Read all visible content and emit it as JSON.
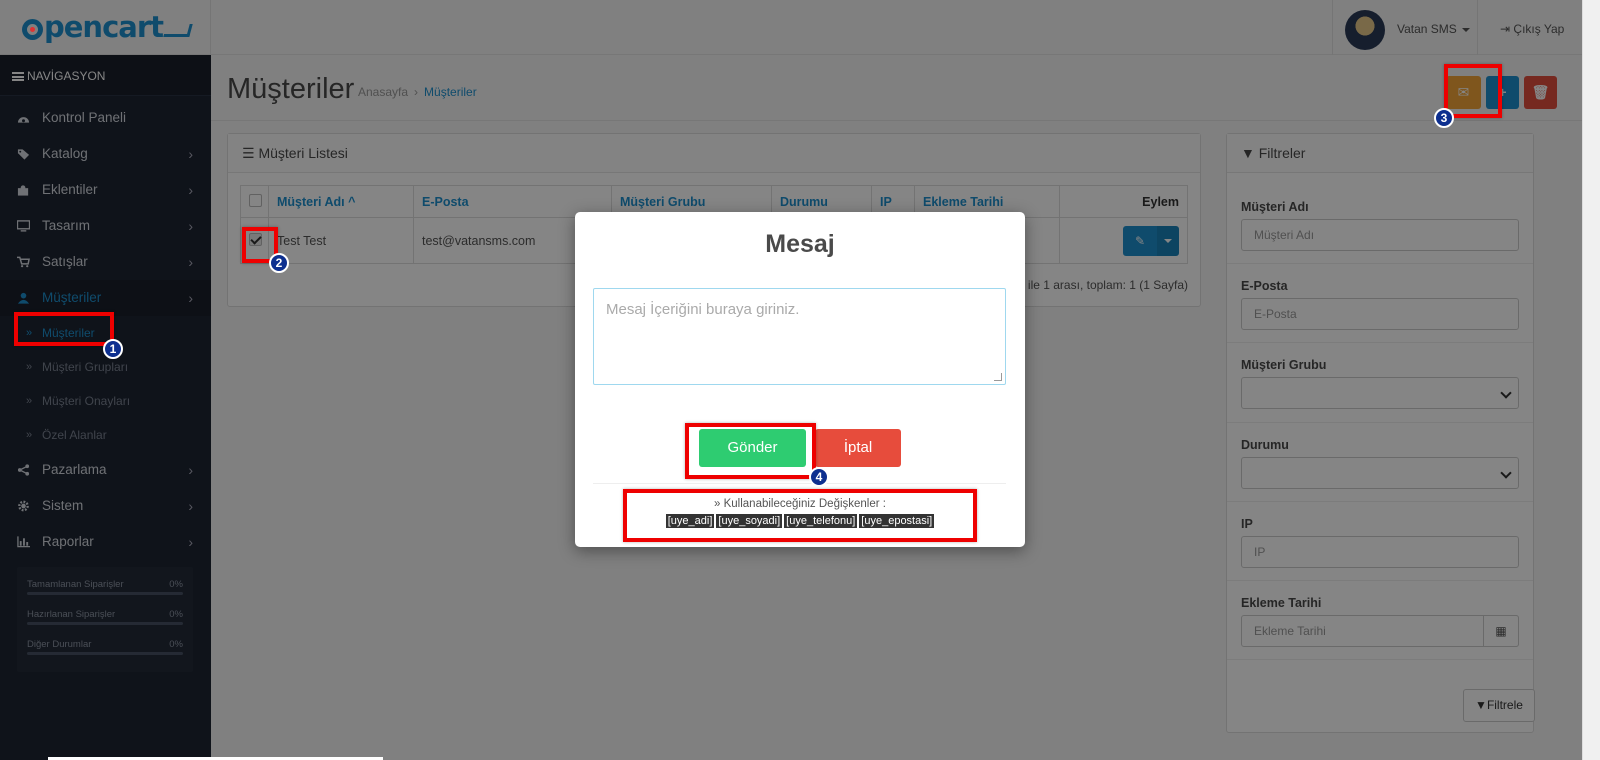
{
  "header": {
    "logo_text": "pencart",
    "user_name": "Vatan SMS",
    "logout_label": "Çıkış Yap"
  },
  "sidebar": {
    "heading": "NAVİGASYON",
    "items": [
      {
        "label": "Kontrol Paneli",
        "icon": "dashboard-icon"
      },
      {
        "label": "Katalog",
        "icon": "tags-icon"
      },
      {
        "label": "Eklentiler",
        "icon": "puzzle-icon"
      },
      {
        "label": "Tasarım",
        "icon": "desktop-icon"
      },
      {
        "label": "Satışlar",
        "icon": "cart-icon"
      },
      {
        "label": "Müşteriler",
        "icon": "user-icon"
      },
      {
        "label": "Pazarlama",
        "icon": "share-icon"
      },
      {
        "label": "Sistem",
        "icon": "gear-icon"
      },
      {
        "label": "Raporlar",
        "icon": "bar-chart-icon"
      }
    ],
    "customer_sub_items": [
      "Müşteriler",
      "Müşteri Grupları",
      "Müşteri Onayları",
      "Özel Alanlar"
    ],
    "stats": [
      {
        "label": "Tamamlanan Siparişler",
        "value": "0%"
      },
      {
        "label": "Hazırlanan Siparişler",
        "value": "0%"
      },
      {
        "label": "Diğer Durumlar",
        "value": "0%"
      }
    ]
  },
  "page": {
    "title": "Müşteriler",
    "breadcrumb_home": "Anasayfa",
    "breadcrumb_current": "Müşteriler"
  },
  "list": {
    "heading": "Müşteri Listesi",
    "columns": [
      "Müşteri Adı",
      "E-Posta",
      "Müşteri Grubu",
      "Durumu",
      "IP",
      "Ekleme Tarihi",
      "Eylem"
    ],
    "row": {
      "name": "Test Test",
      "email": "test@vatansms.com"
    },
    "pagination": "en: 1 ile 1 arası, toplam: 1 (1 Sayfa)"
  },
  "filters": {
    "heading": "Filtreler",
    "name_label": "Müşteri Adı",
    "name_placeholder": "Müşteri Adı",
    "email_label": "E-Posta",
    "email_placeholder": "E-Posta",
    "group_label": "Müşteri Grubu",
    "status_label": "Durumu",
    "ip_label": "IP",
    "ip_placeholder": "IP",
    "date_label": "Ekleme Tarihi",
    "date_placeholder": "Ekleme Tarihi",
    "button_label": "Filtrele"
  },
  "modal": {
    "title": "Mesaj",
    "placeholder": "Mesaj İçeriğini buraya giriniz.",
    "send_label": "Gönder",
    "cancel_label": "İptal",
    "vars_title": "» Kullanabileceğiniz Değişkenler :",
    "vars": [
      "[uye_adi]",
      "[uye_soyadi]",
      "[uye_telefonu]",
      "[uye_epostasi]"
    ]
  },
  "annotations": [
    "1",
    "2",
    "3",
    "4"
  ],
  "colors": {
    "primary": "#1e91cf",
    "warning": "#f3a638",
    "danger": "#e3503e",
    "success": "#2ecc71",
    "sidebar": "#1d2532",
    "highlight": "#ee0000"
  }
}
